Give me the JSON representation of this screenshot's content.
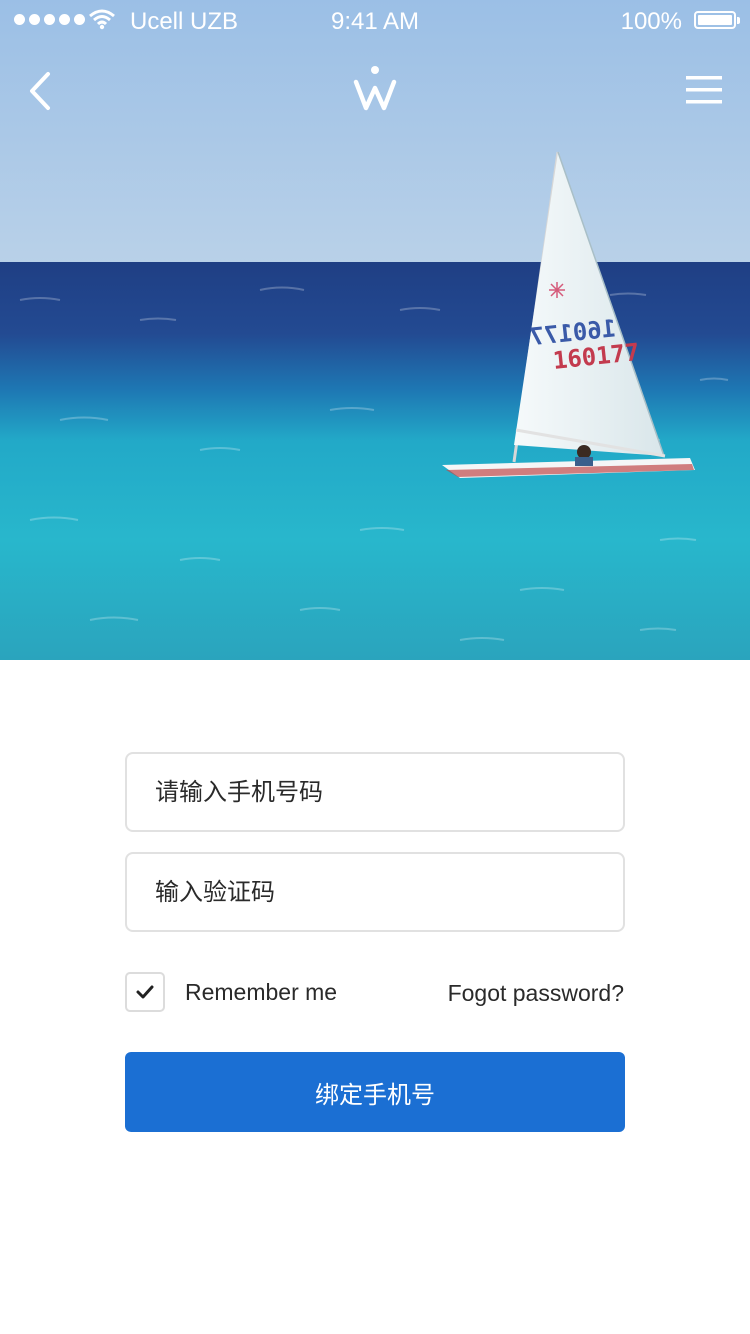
{
  "status_bar": {
    "carrier": "Ucell UZB",
    "time": "9:41 AM",
    "battery": "100%"
  },
  "hero": {
    "sail_number_top": "160177",
    "sail_number_bottom": "160177"
  },
  "form": {
    "phone_placeholder": "请输入手机号码",
    "code_placeholder": "输入验证码",
    "remember_label": "Remember me",
    "remember_checked": true,
    "forgot_label": "Fogot password?",
    "submit_label": "绑定手机号"
  },
  "colors": {
    "primary": "#1b6fd3",
    "field_border": "#e1e1e1"
  },
  "icons": {
    "back": "chevron-left-icon",
    "logo": "w-logo-icon",
    "menu": "hamburger-menu-icon",
    "check": "checkmark-icon"
  }
}
